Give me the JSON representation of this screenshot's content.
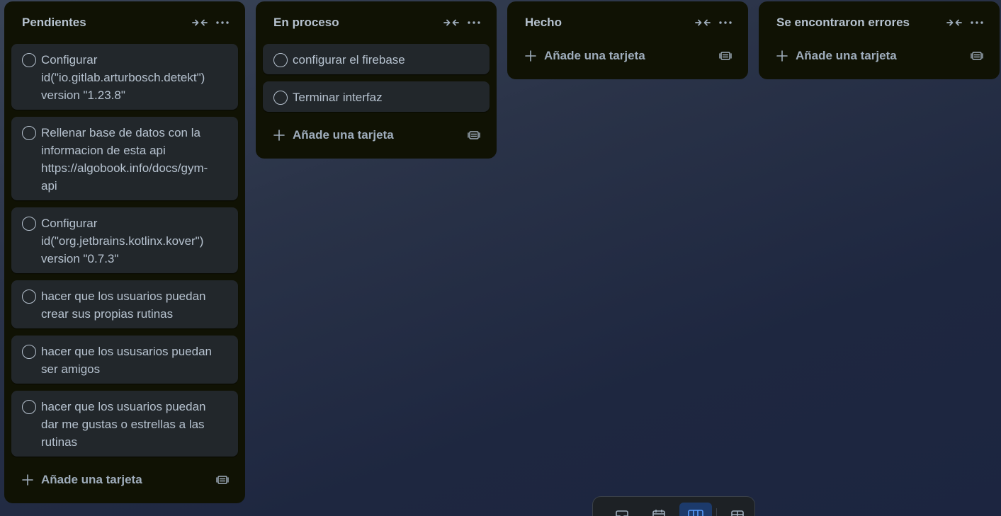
{
  "lists": [
    {
      "title": "Pendientes",
      "cards": [
        "Configurar\nid(\"io.gitlab.arturbosch.detekt\")\nversion \"1.23.8\"",
        "Rellenar base de datos con la\ninformacion de esta api\nhttps://algobook.info/docs/gym-\napi",
        "Configurar\nid(\"org.jetbrains.kotlinx.kover\")\nversion \"0.7.3\"",
        "hacer que los usuarios puedan\ncrear sus propias rutinas",
        "hacer que los ususarios puedan\nser amigos",
        "hacer que los usuarios puedan\ndar me gustas o estrellas a las\nrutinas"
      ],
      "add_label": "Añade una tarjeta"
    },
    {
      "title": "En proceso",
      "cards": [
        "configurar el firebase",
        "Terminar interfaz"
      ],
      "add_label": "Añade una tarjeta"
    },
    {
      "title": "Hecho",
      "cards": [],
      "add_label": "Añade una tarjeta"
    },
    {
      "title": "Se encontraron errores",
      "cards": [],
      "add_label": "Añade una tarjeta"
    }
  ],
  "icons": {
    "collapse": "collapse-icon",
    "more": "more-icon",
    "add": "plus-icon",
    "template": "card-template-icon"
  },
  "colors": {
    "list_bg": "#101204",
    "card_bg": "#22272b",
    "text": "#b6c2cf",
    "active_view": "#579dff"
  },
  "bottom_bar": {
    "buttons": [
      "inbox-icon",
      "calendar-icon",
      "board-icon",
      "switch-boards-icon"
    ],
    "active": "board-icon"
  }
}
